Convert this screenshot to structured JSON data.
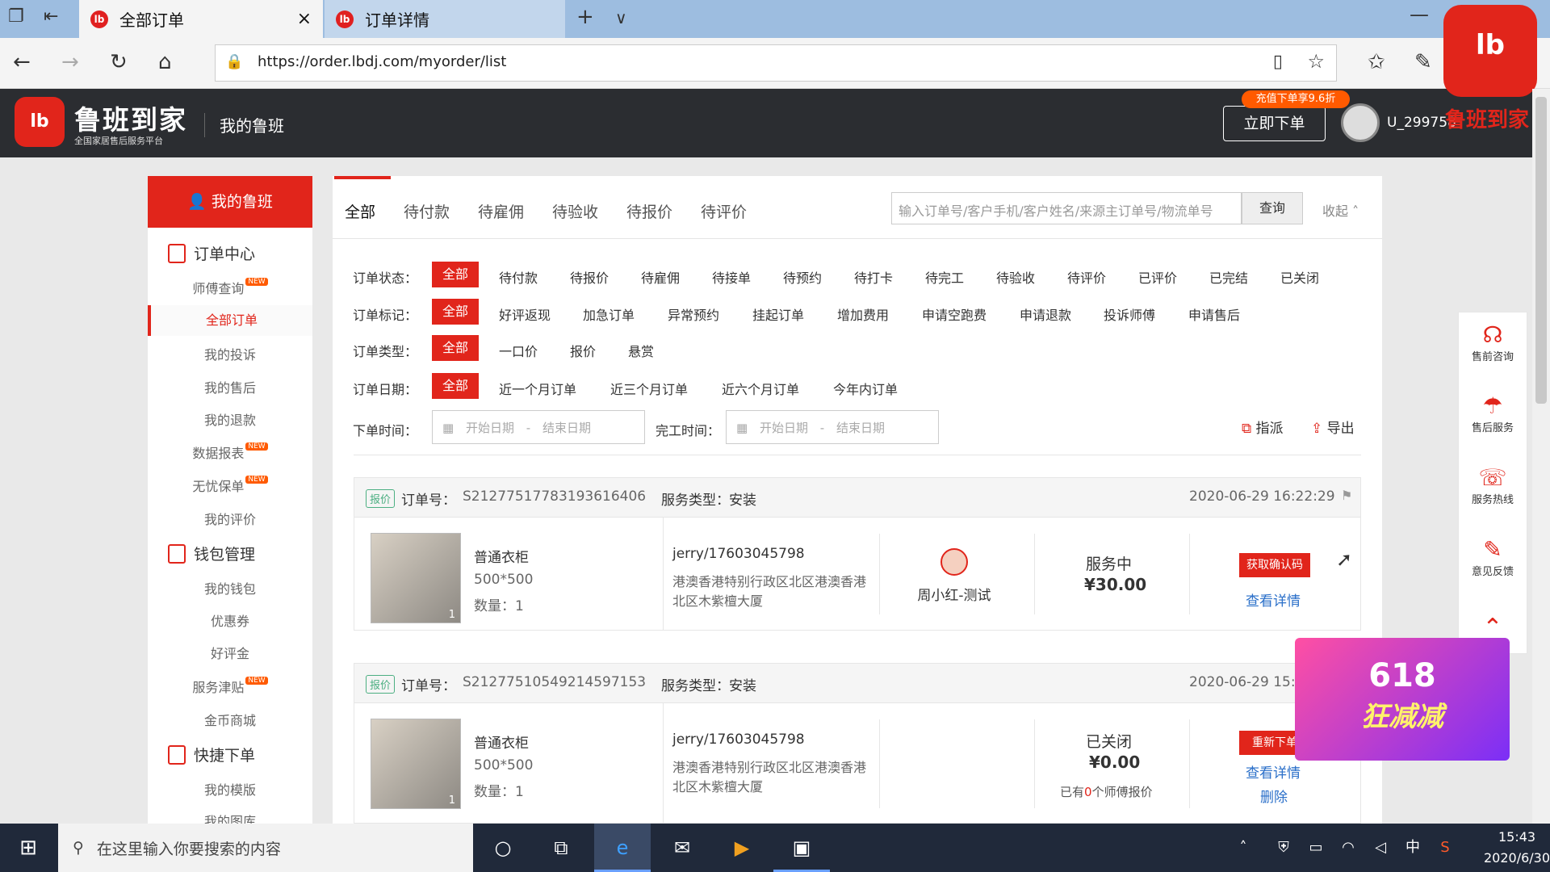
{
  "browser": {
    "tabs": [
      {
        "label": "全部订单",
        "close": "×"
      },
      {
        "label": "订单详情"
      }
    ],
    "new_tab": "+",
    "tab_menu": "∨",
    "url": "https://order.lbdj.com/myorder/list"
  },
  "header": {
    "brand": "鲁班到家",
    "brand_sub": "全国家居售后服务平台",
    "section": "我的鲁班",
    "promo": "充值下单享9.6折",
    "order_now": "立即下单",
    "username": "U_299758",
    "corner_brand": "鲁班到家"
  },
  "sidebar": {
    "home": "我的鲁班",
    "groups": [
      {
        "title": "订单中心",
        "items": [
          {
            "label": "师傅查询",
            "new": "NEW"
          },
          {
            "label": "全部订单"
          },
          {
            "label": "我的投诉"
          },
          {
            "label": "我的售后"
          },
          {
            "label": "我的退款"
          },
          {
            "label": "数据报表",
            "new": "NEW"
          },
          {
            "label": "无忧保单",
            "new": "NEW"
          },
          {
            "label": "我的评价"
          }
        ]
      },
      {
        "title": "钱包管理",
        "items": [
          {
            "label": "我的钱包"
          },
          {
            "label": "优惠券"
          },
          {
            "label": "好评金"
          },
          {
            "label": "服务津贴",
            "new": "NEW"
          },
          {
            "label": "金币商城"
          }
        ]
      },
      {
        "title": "快捷下单",
        "items": [
          {
            "label": "我的模版"
          },
          {
            "label": "我的图库"
          }
        ]
      }
    ]
  },
  "main": {
    "tabs": [
      "全部",
      "待付款",
      "待雇佣",
      "待验收",
      "待报价",
      "待评价"
    ],
    "search_placeholder": "输入订单号/客户手机/客户姓名/来源主订单号/物流单号",
    "query": "查询",
    "collapse": "收起",
    "filters": {
      "status": {
        "label": "订单状态：",
        "options": [
          "全部",
          "待付款",
          "待报价",
          "待雇佣",
          "待接单",
          "待预约",
          "待打卡",
          "待完工",
          "待验收",
          "待评价",
          "已评价",
          "已完结",
          "已关闭"
        ]
      },
      "mark": {
        "label": "订单标记：",
        "options": [
          "全部",
          "好评返现",
          "加急订单",
          "异常预约",
          "挂起订单",
          "增加费用",
          "申请空跑费",
          "申请退款",
          "投诉师傅",
          "申请售后"
        ]
      },
      "type": {
        "label": "订单类型：",
        "options": [
          "全部",
          "一口价",
          "报价",
          "悬赏"
        ]
      },
      "date": {
        "label": "订单日期：",
        "options": [
          "全部",
          "近一个月订单",
          "近三个月订单",
          "近六个月订单",
          "今年内订单"
        ]
      }
    },
    "order_time_label": "下单时间：",
    "finish_time_label": "完工时间：",
    "start_date": "开始日期",
    "end_date": "结束日期",
    "date_sep": "-",
    "assign": "指派",
    "export": "导出",
    "orders": [
      {
        "tag": "报价",
        "order_no_label": "订单号：",
        "order_no": "S2127751778319361640​6",
        "service_label": "服务类型：",
        "service": "安装",
        "time": "2020-06-29 16:22:29",
        "product": "普通衣柜",
        "size": "500*500",
        "qty": "数量：1",
        "thumb_count": "1",
        "customer": "jerry/17603045798",
        "address": "港澳香港特别行政区北区港澳香港北区木紫檀大厦",
        "worker": "周小红-测试",
        "status": "服务中",
        "price": "¥30.00",
        "action": "获取确认码",
        "detail": "查看详情"
      },
      {
        "tag": "报价",
        "order_no_label": "订单号：",
        "order_no": "S2127751054921459715​3",
        "service_label": "服务类型：",
        "service": "安装",
        "time": "2020-06-29 15:",
        "product": "普通衣柜",
        "size": "500*500",
        "qty": "数量：1",
        "thumb_count": "1",
        "customer": "jerry/17603045798",
        "address": "港澳香港特别行政区北区港澳香港北区木紫檀大厦",
        "status": "已关闭",
        "price": "¥0.00",
        "quote_prefix": "已有",
        "quote_count": "0",
        "quote_suffix": "个师傅报价",
        "action": "重新下单",
        "detail": "查看详情",
        "delete": "删除"
      }
    ]
  },
  "rightbar": [
    "售前咨询",
    "售后服务",
    "服务热线",
    "意见反馈"
  ],
  "banner": {
    "title": "618",
    "subtitle": "狂减减"
  },
  "taskbar": {
    "search_placeholder": "在这里输入你要搜索的内容",
    "time": "15:43",
    "date": "2020/6/30",
    "ime": "中"
  },
  "colors": {
    "accent": "#e1251b",
    "link": "#2a6fc9",
    "quote_tag": "#4caf82"
  }
}
